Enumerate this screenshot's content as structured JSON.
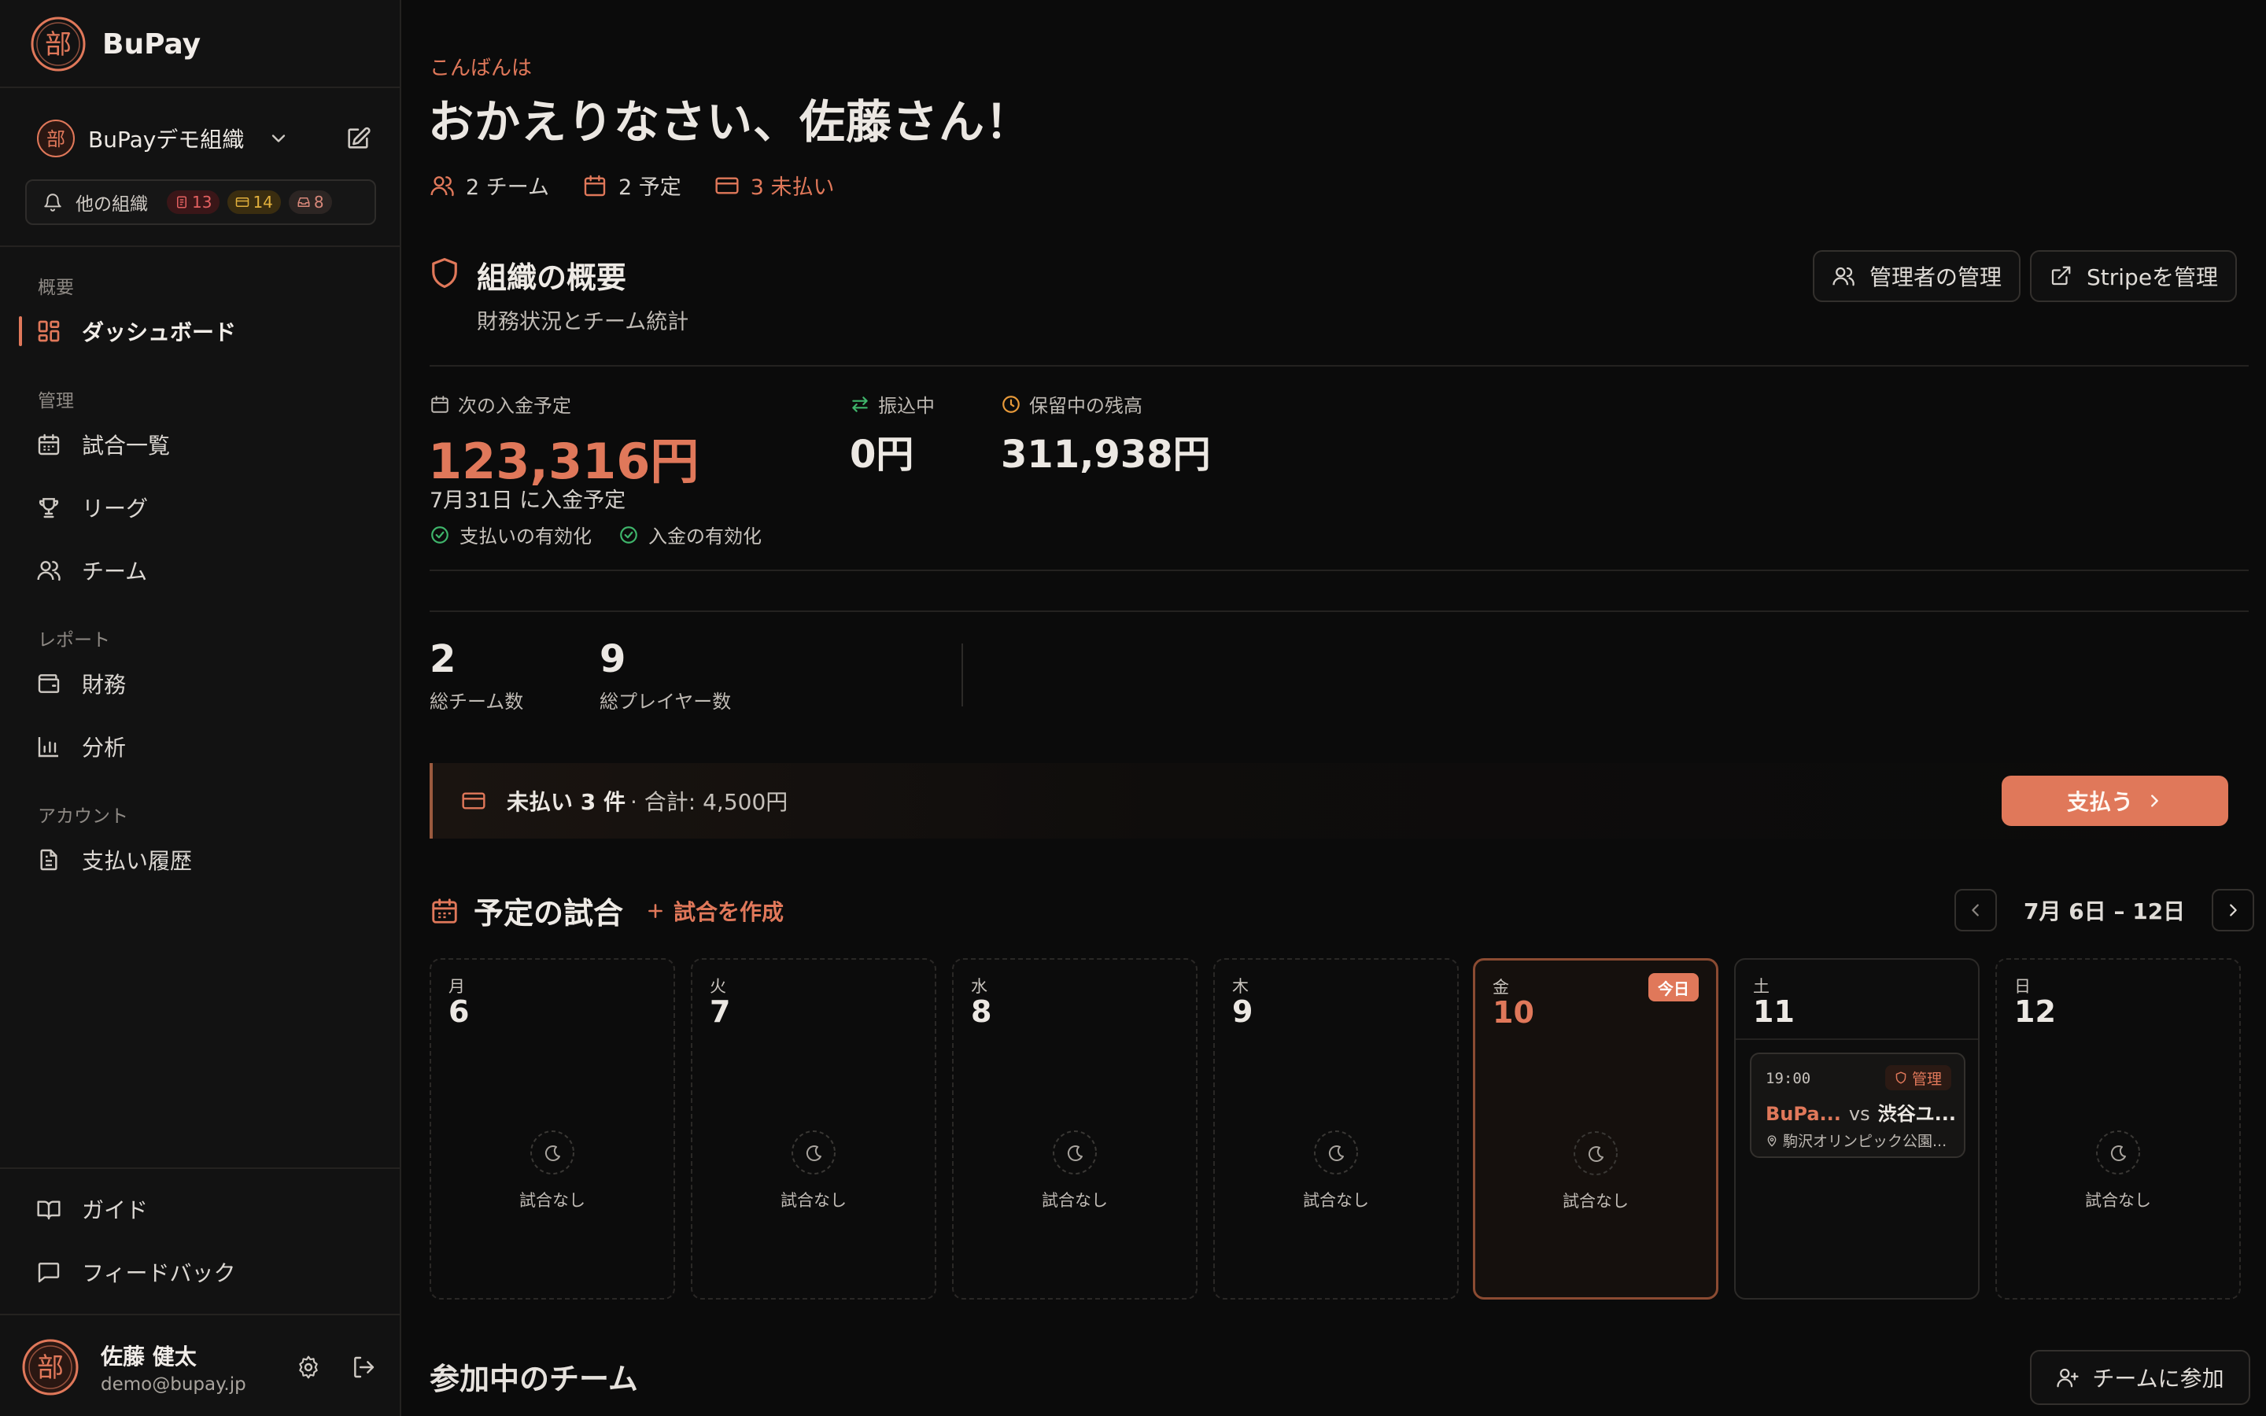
{
  "app": {
    "name": "BuPay",
    "logo_char": "部"
  },
  "org": {
    "name": "BuPayデモ組織",
    "logo_char": "部"
  },
  "other_orgs": {
    "label": "他の組織",
    "badges": [
      "13",
      "14",
      "8"
    ]
  },
  "nav": {
    "sections": {
      "overview": "概要",
      "manage": "管理",
      "report": "レポート",
      "account": "アカウント"
    },
    "items": {
      "dashboard": "ダッシュボード",
      "matches": "試合一覧",
      "league": "リーグ",
      "team": "チーム",
      "finance": "財務",
      "analytics": "分析",
      "payment_history": "支払い履歴"
    },
    "footer": {
      "guide": "ガイド",
      "feedback": "フィードバック"
    }
  },
  "user": {
    "name": "佐藤 健太",
    "email": "demo@bupay.jp",
    "avatar_char": "部"
  },
  "greeting": {
    "small": "こんばんは",
    "title": "おかえりなさい、佐藤さん！",
    "summary": {
      "teams": "2 チーム",
      "schedules": "2 予定",
      "unpaid": "3 未払い"
    }
  },
  "org_overview": {
    "title": "組織の概要",
    "subtitle": "財務状況とチーム統計",
    "btn_admins": "管理者の管理",
    "btn_stripe": "Stripeを管理"
  },
  "finance": {
    "next_payout_label": "次の入金予定",
    "next_payout_amount": "123,316円",
    "next_payout_date": "7月31日 に入金予定",
    "in_transit_label": "振込中",
    "in_transit_amount": "0円",
    "pending_label": "保留中の残高",
    "pending_amount": "311,938円",
    "check_payments": "支払いの有効化",
    "check_payouts": "入金の有効化"
  },
  "stats": {
    "teams_value": "2",
    "teams_label": "総チーム数",
    "players_value": "9",
    "players_label": "総プレイヤー数"
  },
  "unpaid": {
    "strong": "未払い 3 件",
    "rest": "· 合計: 4,500円",
    "pay_button": "支払う"
  },
  "upcoming": {
    "title": "予定の試合",
    "create": "試合を作成",
    "week_label": "7月 6日 – 12日",
    "empty_text": "試合なし",
    "today_badge": "今日",
    "days": [
      {
        "wd": "月",
        "num": "6"
      },
      {
        "wd": "火",
        "num": "7"
      },
      {
        "wd": "水",
        "num": "8"
      },
      {
        "wd": "木",
        "num": "9"
      },
      {
        "wd": "金",
        "num": "10"
      },
      {
        "wd": "土",
        "num": "11"
      },
      {
        "wd": "日",
        "num": "12"
      }
    ],
    "match": {
      "time": "19:00",
      "badge": "管理",
      "home": "BuPa...",
      "vs": "vs",
      "away": "渋谷ユ...",
      "venue": "駒沢オリンピック公園..."
    }
  },
  "teams_section": {
    "title": "参加中のチーム",
    "join_button": "チームに参加"
  },
  "colors": {
    "accent": "#e0785a",
    "background": "#0b0b0b",
    "sidebar": "#121212"
  }
}
